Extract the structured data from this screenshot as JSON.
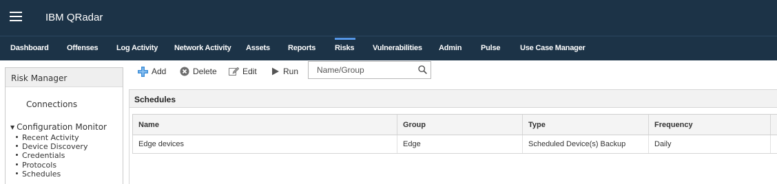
{
  "app": {
    "title": "IBM QRadar"
  },
  "nav": {
    "active": "Risks",
    "items": [
      "Dashboard",
      "Offenses",
      "Log Activity",
      "Network Activity",
      "Assets",
      "Reports",
      "Risks",
      "Vulnerabilities",
      "Admin",
      "Pulse",
      "Use Case Manager"
    ]
  },
  "sidebar": {
    "title": "Risk Manager",
    "connections_label": "Connections",
    "config_monitor_label": "Configuration Monitor",
    "sub_items": [
      "Recent Activity",
      "Device Discovery",
      "Credentials",
      "Protocols",
      "Schedules"
    ]
  },
  "toolbar": {
    "add_label": "Add",
    "delete_label": "Delete",
    "edit_label": "Edit",
    "run_label": "Run",
    "search_placeholder": "Name/Group"
  },
  "section": {
    "title": "Schedules"
  },
  "table": {
    "columns": [
      "Name",
      "Group",
      "Type",
      "Frequency"
    ],
    "rows": [
      {
        "name": "Edge devices",
        "group": "Edge",
        "type": "Scheduled Device(s) Backup",
        "frequency": "Daily"
      }
    ]
  },
  "colors": {
    "header_bg": "#1c3347",
    "active_tab_indicator": "#5596e6",
    "add_icon": "#3d8ed8"
  },
  "icons": {
    "menu": "hamburger-icon",
    "add": "plus-icon",
    "delete": "delete-circle-icon",
    "edit": "edit-icon",
    "run": "play-icon",
    "search": "search-icon",
    "expand": "triangle-down-icon"
  }
}
